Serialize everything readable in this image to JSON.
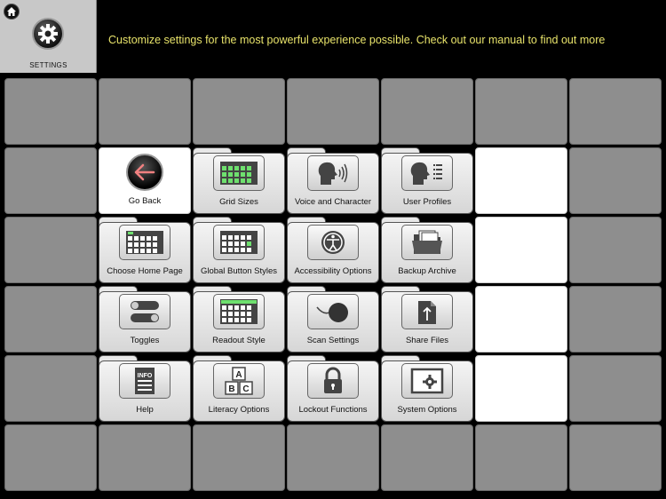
{
  "header": {
    "settings_label": "SETTINGS",
    "banner": "Customize settings for the most powerful experience possible.  Check out our manual to find out more"
  },
  "buttons": {
    "go_back": "Go Back",
    "grid_sizes": "Grid Sizes",
    "voice_and_character": "Voice and Character",
    "user_profiles": "User Profiles",
    "choose_home_page": "Choose Home Page",
    "global_button_styles": "Global Button Styles",
    "accessibility_options": "Accessibility Options",
    "backup_archive": "Backup Archive",
    "toggles": "Toggles",
    "readout_style": "Readout Style",
    "scan_settings": "Scan Settings",
    "share_files": "Share Files",
    "help": "Help",
    "literacy_options": "Literacy Options",
    "lockout_functions": "Lockout Functions",
    "system_options": "System Options"
  },
  "icons": {
    "home": "home-icon",
    "gear": "gear-icon",
    "back": "back-arrow-icon",
    "info_label": "INFO",
    "letters": [
      "A",
      "B",
      "C"
    ]
  },
  "colors": {
    "banner_text": "#e8e36a",
    "grid_green": "#6ee06e",
    "empty_cell": "#8e8e8e"
  }
}
